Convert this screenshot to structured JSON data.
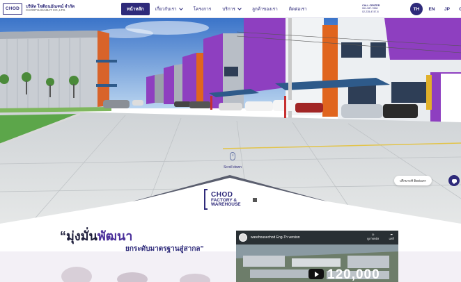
{
  "header": {
    "logo_text": "CHOD",
    "company_th": "บริษัท โชติธนมัณฑน์ จำกัด",
    "company_en": "CHODTHANAMAT CO.,LTD.",
    "nav": [
      {
        "label": "หน้าหลัก",
        "active": true,
        "dropdown": false
      },
      {
        "label": "เกี่ยวกับเรา",
        "active": false,
        "dropdown": true
      },
      {
        "label": "โครงการ",
        "active": false,
        "dropdown": false
      },
      {
        "label": "บริการ",
        "active": false,
        "dropdown": true
      },
      {
        "label": "ลูกค้าของเรา",
        "active": false,
        "dropdown": false
      },
      {
        "label": "ติดต่อเรา",
        "active": false,
        "dropdown": false
      }
    ],
    "call_center_label": "CALL CENTER",
    "call_numbers": [
      "061-987-7658",
      "02-235-4747-8"
    ],
    "languages": [
      {
        "code": "TH",
        "active": true
      },
      {
        "code": "EN",
        "active": false
      },
      {
        "code": "JP",
        "active": false
      },
      {
        "code": "CH",
        "active": false
      }
    ]
  },
  "hero": {
    "scroll_label": "Scroll down",
    "chat_label": "ปรึกษาฟรี ติดต่อเรา"
  },
  "brand_block": {
    "line1": "CHOD",
    "line2": "FACTORY &",
    "line3": "WAREHOUSE"
  },
  "slogan": {
    "quote_open": "“",
    "part1": "มุ่งมั่น",
    "part2": "พัฒนา",
    "line2": "ยกระดับมาตรฐานสู่สากล”"
  },
  "video": {
    "title": "warehousechod Eng-Th version",
    "watch_later": "ดูภายหลัง",
    "share": "แชร์",
    "overlay_number": "120,000"
  },
  "colors": {
    "brand": "#2e2a7a",
    "purple": "#8e3fc0",
    "orange": "#e0651e"
  }
}
